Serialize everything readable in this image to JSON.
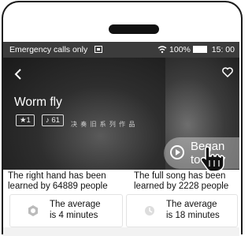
{
  "status_bar": {
    "left_text": "Emergency calls only",
    "battery": "100%",
    "time": "15: 00"
  },
  "cards": [
    {
      "title": "Worm fly",
      "tag_star": "1",
      "tag_count": "61",
      "caption": "决 奏 旧 系 列 作 品",
      "info": "The right hand has been learned by 64889 people",
      "stat_line1": "The average",
      "stat_line2": "is 4 minutes"
    },
    {
      "info": "The full song has been learned by 2228 people",
      "stat_line1": "The average",
      "stat_line2": "is 18 minutes"
    }
  ],
  "play_button": {
    "line1": "Began",
    "line2": "to play"
  },
  "icons": {
    "back": "back-arrow-icon",
    "favorite": "heart-icon",
    "play": "play-icon",
    "hand": "hand-pointer-icon"
  }
}
